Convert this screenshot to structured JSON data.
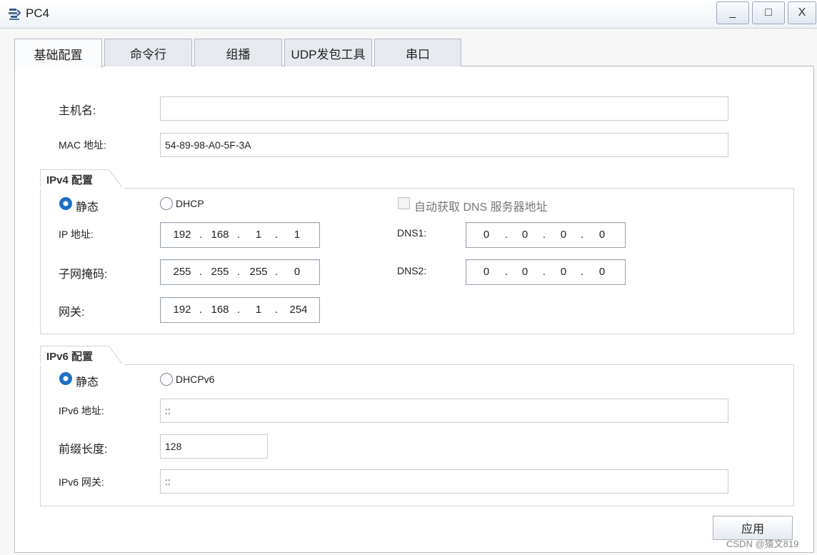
{
  "window": {
    "title": "PC4",
    "min_glyph": "_",
    "max_glyph": "□",
    "close_glyph": "X"
  },
  "tabs": [
    "基础配置",
    "命令行",
    "组播",
    "UDP发包工具",
    "串口"
  ],
  "basic": {
    "hostname_label": "主机名:",
    "hostname_value": "",
    "mac_label": "MAC 地址:",
    "mac_value": "54-89-98-A0-5F-3A"
  },
  "ipv4": {
    "group_title": "IPv4 配置",
    "static_label": "静态",
    "dhcp_label": "DHCP",
    "auto_dns_label": "自动获取 DNS 服务器地址",
    "ip_label": "IP 地址:",
    "ip": [
      "192",
      "168",
      "1",
      "1"
    ],
    "mask_label": "子网掩码:",
    "mask": [
      "255",
      "255",
      "255",
      "0"
    ],
    "gateway_label": "网关:",
    "gateway": [
      "192",
      "168",
      "1",
      "254"
    ],
    "dns1_label": "DNS1:",
    "dns1": [
      "0",
      "0",
      "0",
      "0"
    ],
    "dns2_label": "DNS2:",
    "dns2": [
      "0",
      "0",
      "0",
      "0"
    ],
    "static_selected": true
  },
  "ipv6": {
    "group_title": "IPv6 配置",
    "static_label": "静态",
    "dhcp_label": "DHCPv6",
    "addr_label": "IPv6 地址:",
    "addr_value": "::",
    "prefix_label": "前缀长度:",
    "prefix_value": "128",
    "gateway_label": "IPv6 网关:",
    "gateway_value": "::",
    "static_selected": true
  },
  "apply_label": "应用",
  "watermark": "CSDN @猿文819",
  "colors": {
    "radio_selected": "#1f6fc5",
    "panel": "#ffffff",
    "tab_inactive": "#e6e9ee"
  }
}
